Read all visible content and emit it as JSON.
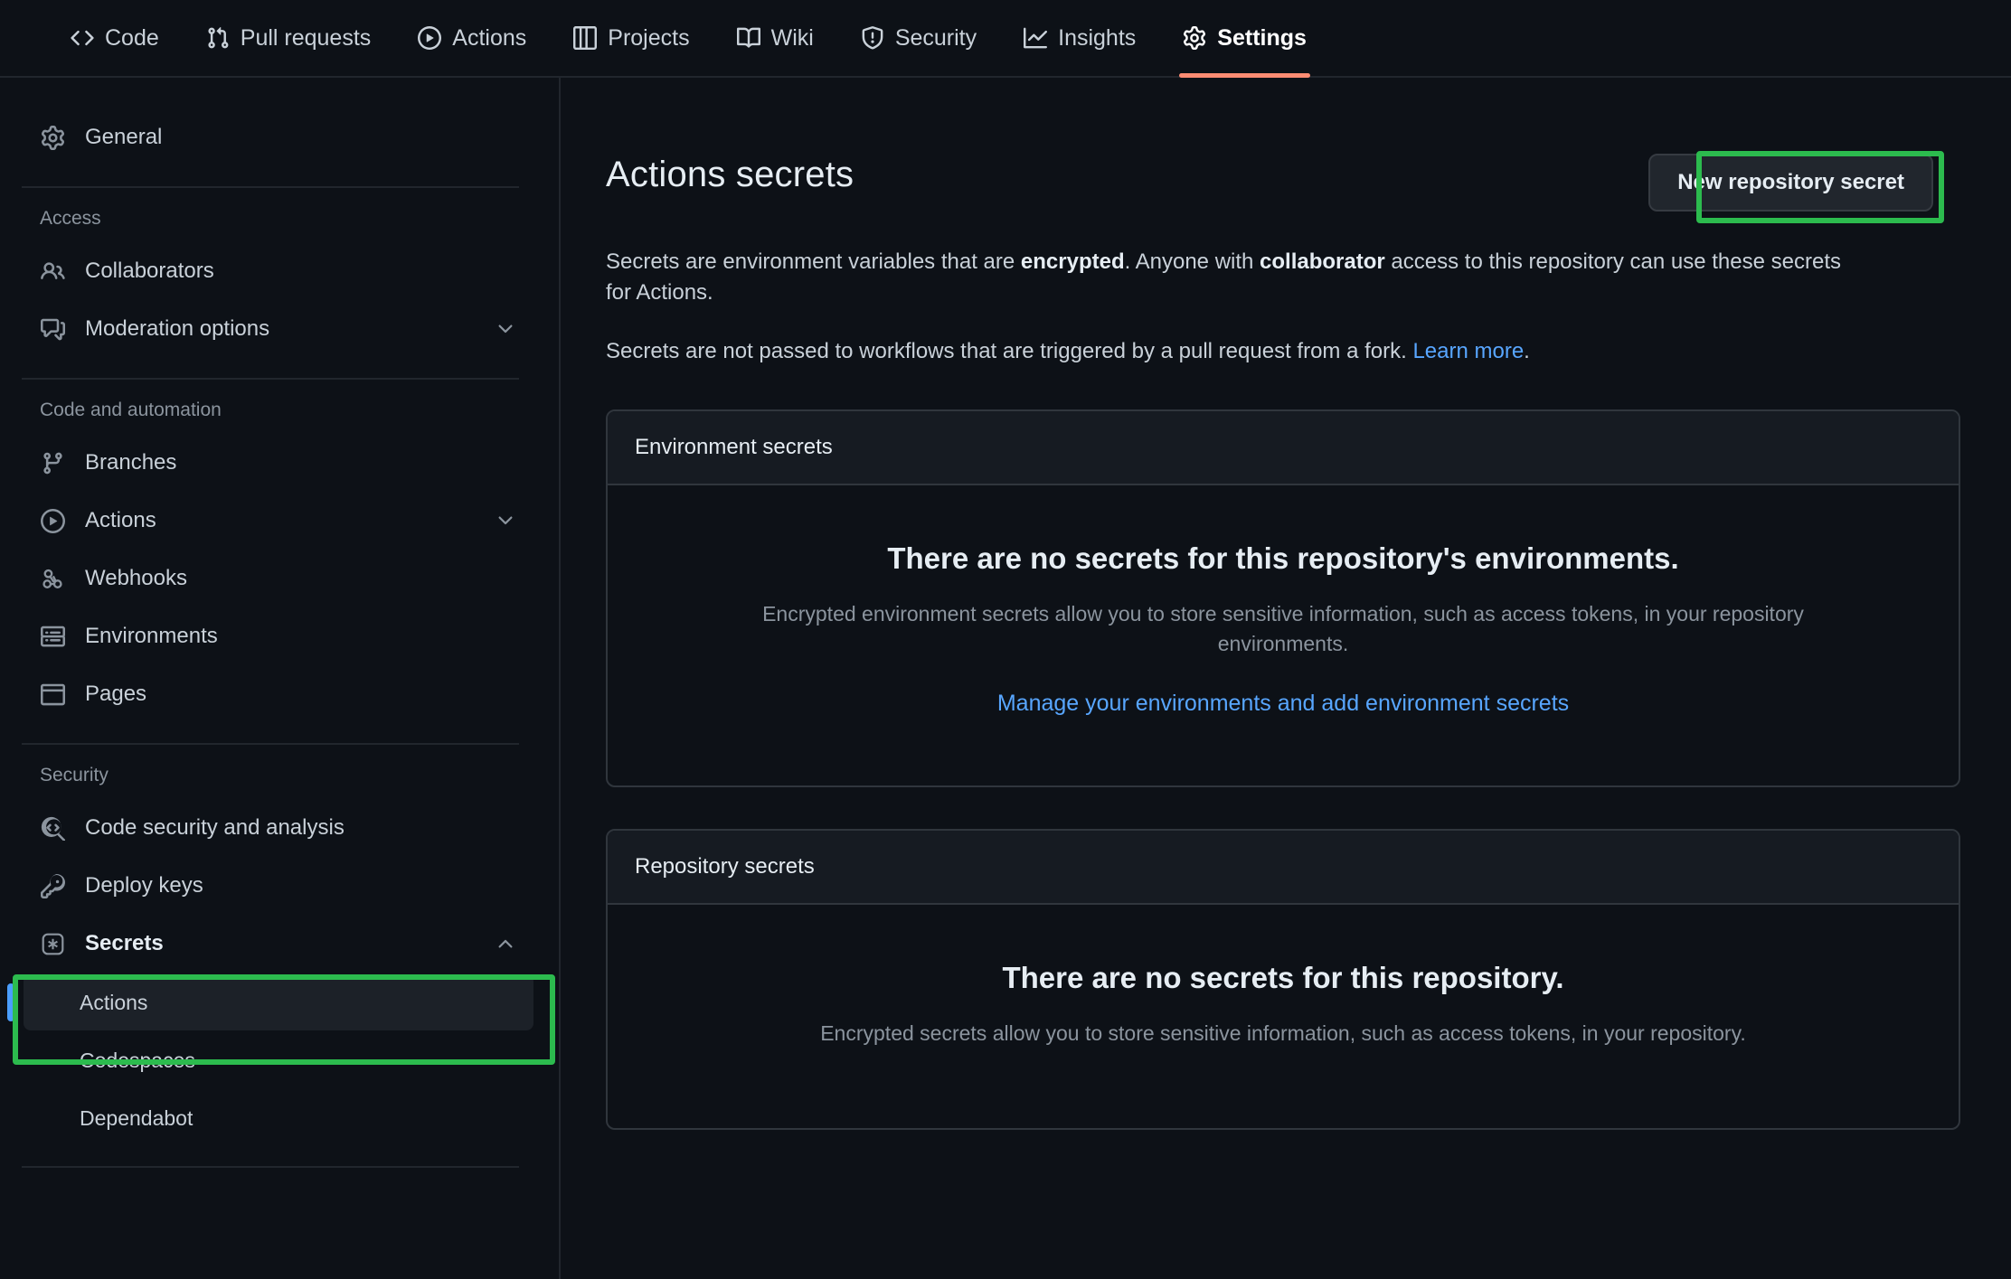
{
  "topnav": {
    "tabs": [
      {
        "label": "Code",
        "icon": "code-icon",
        "active": false
      },
      {
        "label": "Pull requests",
        "icon": "git-pull-request-icon",
        "active": false
      },
      {
        "label": "Actions",
        "icon": "play-circle-icon",
        "active": false
      },
      {
        "label": "Projects",
        "icon": "table-icon",
        "active": false
      },
      {
        "label": "Wiki",
        "icon": "book-icon",
        "active": false
      },
      {
        "label": "Security",
        "icon": "shield-icon",
        "active": false
      },
      {
        "label": "Insights",
        "icon": "graph-icon",
        "active": false
      },
      {
        "label": "Settings",
        "icon": "gear-icon",
        "active": true
      }
    ]
  },
  "sidebar": {
    "general": {
      "label": "General",
      "icon": "gear-icon"
    },
    "groups": [
      {
        "title": "Access",
        "items": [
          {
            "label": "Collaborators",
            "icon": "people-icon",
            "chevron": null
          },
          {
            "label": "Moderation options",
            "icon": "comment-discussion-icon",
            "chevron": "chevron-down-icon"
          }
        ]
      },
      {
        "title": "Code and automation",
        "items": [
          {
            "label": "Branches",
            "icon": "git-branch-icon",
            "chevron": null
          },
          {
            "label": "Actions",
            "icon": "play-circle-icon",
            "chevron": "chevron-down-icon"
          },
          {
            "label": "Webhooks",
            "icon": "webhook-icon",
            "chevron": null
          },
          {
            "label": "Environments",
            "icon": "server-icon",
            "chevron": null
          },
          {
            "label": "Pages",
            "icon": "browser-icon",
            "chevron": null
          }
        ]
      },
      {
        "title": "Security",
        "items": [
          {
            "label": "Code security and analysis",
            "icon": "codescan-icon",
            "chevron": null
          },
          {
            "label": "Deploy keys",
            "icon": "key-icon",
            "chevron": null
          },
          {
            "label": "Secrets",
            "icon": "key-asterisk-icon",
            "chevron": "chevron-up-icon"
          }
        ]
      }
    ],
    "secrets_children": [
      {
        "label": "Actions",
        "selected": true
      },
      {
        "label": "Codespaces",
        "selected": false
      },
      {
        "label": "Dependabot",
        "selected": false
      }
    ]
  },
  "main": {
    "page_title": "Actions secrets",
    "new_secret_button": "New repository secret",
    "paragraph1": {
      "part1": "Secrets are environment variables that are ",
      "bold1": "encrypted",
      "part2": ". Anyone with ",
      "bold2": "collaborator",
      "part3": " access to this repository can use these secrets for Actions."
    },
    "paragraph2": {
      "text": "Secrets are not passed to workflows that are triggered by a pull request from a fork. ",
      "link": "Learn more",
      "suffix": "."
    },
    "cards": [
      {
        "header": "Environment secrets",
        "blank_title": "There are no secrets for this repository's environments.",
        "blank_sub": "Encrypted environment secrets allow you to store sensitive information, such as access tokens, in your repository environments.",
        "blank_link": "Manage your environments and add environment secrets"
      },
      {
        "header": "Repository secrets",
        "blank_title": "There are no secrets for this repository.",
        "blank_sub": "Encrypted secrets allow you to store sensitive information, such as access tokens, in your repository.",
        "blank_link": null
      }
    ]
  },
  "colors": {
    "highlight_green": "#2cbb4e",
    "active_tab_underline": "#fd8c73",
    "link_blue": "#58a6ff",
    "selected_item_bar": "#4a9eff",
    "page_background": "#0d1117",
    "card_header_background": "#161b22"
  }
}
